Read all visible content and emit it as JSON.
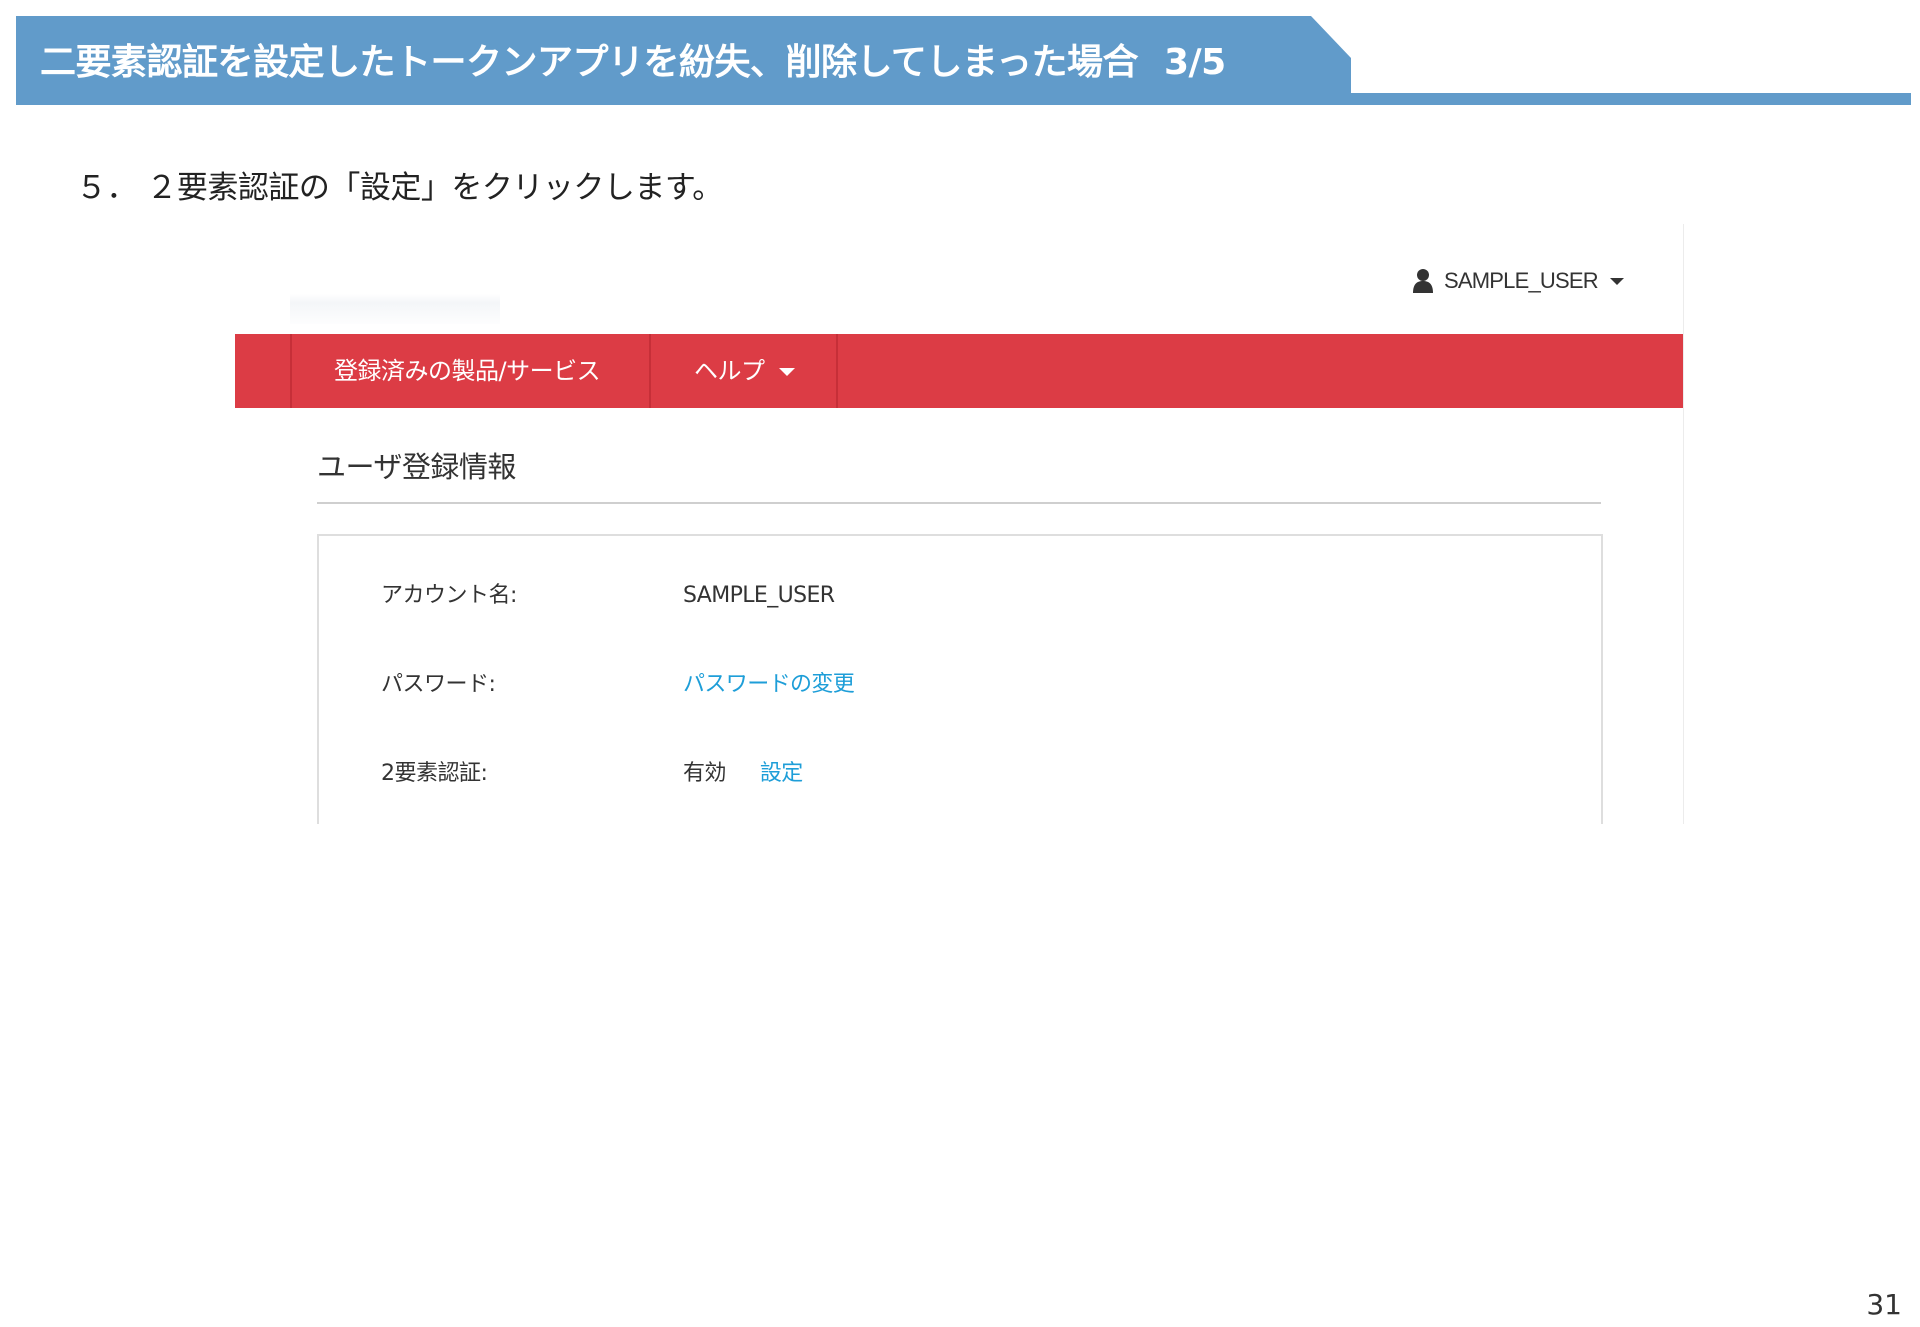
{
  "slide": {
    "title": "二要素認証を設定したトークンアプリを紛失、削除してしまった場合",
    "page_fraction": "3/5",
    "step": "５． ２要素認証の「設定」をクリックします。",
    "page_number": "31"
  },
  "screenshot": {
    "user_menu": {
      "username": "SAMPLE_USER",
      "icon": "user-icon"
    },
    "navbar": {
      "items": [
        {
          "label": "登録済みの製品/サービス"
        },
        {
          "label": "ヘルプ"
        }
      ],
      "color": "#dc3c45"
    },
    "section_title": "ユーザ登録情報",
    "rows": {
      "account": {
        "label": "アカウント名:",
        "value": "SAMPLE_USER"
      },
      "password": {
        "label": "パスワード:",
        "link": "パスワードの変更"
      },
      "twofactor": {
        "label": "2要素認証:",
        "status": "有効",
        "link": "設定"
      }
    },
    "link_color": "#1e9ed8"
  },
  "colors": {
    "header": "#619bca"
  }
}
